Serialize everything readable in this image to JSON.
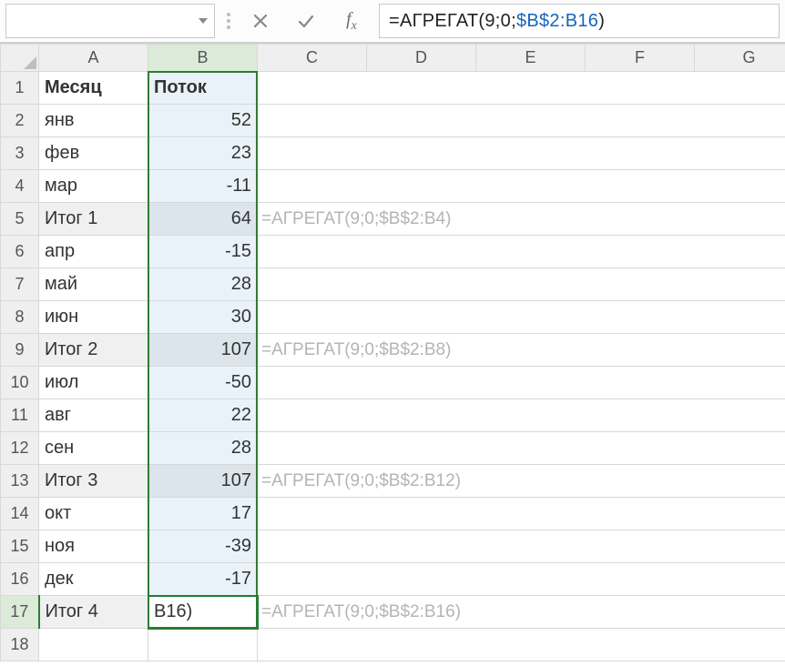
{
  "formula_bar": {
    "name_box_value": "",
    "formula_prefix": "=АГРЕГАТ(9;0;",
    "formula_ref": "$B$2:B16",
    "formula_suffix": ")"
  },
  "columns": [
    "A",
    "B",
    "C",
    "D",
    "E",
    "F",
    "G"
  ],
  "rows": [
    {
      "n": 1,
      "a": "Месяц",
      "b": "Поток",
      "header": true
    },
    {
      "n": 2,
      "a": "янв",
      "b": "52"
    },
    {
      "n": 3,
      "a": "фев",
      "b": "23"
    },
    {
      "n": 4,
      "a": "мар",
      "b": "-11"
    },
    {
      "n": 5,
      "a": "Итог 1",
      "b": "64",
      "shade": true,
      "c": "=АГРЕГАТ(9;0;$B$2:B4)"
    },
    {
      "n": 6,
      "a": "апр",
      "b": "-15"
    },
    {
      "n": 7,
      "a": "май",
      "b": "28"
    },
    {
      "n": 8,
      "a": "июн",
      "b": "30"
    },
    {
      "n": 9,
      "a": "Итог 2",
      "b": "107",
      "shade": true,
      "c": "=АГРЕГАТ(9;0;$B$2:B8)"
    },
    {
      "n": 10,
      "a": "июл",
      "b": "-50"
    },
    {
      "n": 11,
      "a": "авг",
      "b": "22"
    },
    {
      "n": 12,
      "a": "сен",
      "b": "28"
    },
    {
      "n": 13,
      "a": "Итог 3",
      "b": "107",
      "shade": true,
      "c": "=АГРЕГАТ(9;0;$B$2:B12)"
    },
    {
      "n": 14,
      "a": "окт",
      "b": "17"
    },
    {
      "n": 15,
      "a": "ноя",
      "b": "-39"
    },
    {
      "n": 16,
      "a": "дек",
      "b": "-17"
    },
    {
      "n": 17,
      "a": "Итог 4",
      "b": "B16)",
      "shade": true,
      "active": true,
      "c": "=АГРЕГАТ(9;0;$B$2:B16)"
    },
    {
      "n": 18,
      "a": "",
      "b": ""
    }
  ],
  "selection": {
    "top_row": 1,
    "bottom_row": 17,
    "col": "B"
  },
  "icons": {
    "cancel": "cancel-icon",
    "enter": "enter-icon",
    "fx": "fx-icon",
    "dropdown": "chevron-down-icon",
    "select_all_triangle": "select-all-icon"
  }
}
